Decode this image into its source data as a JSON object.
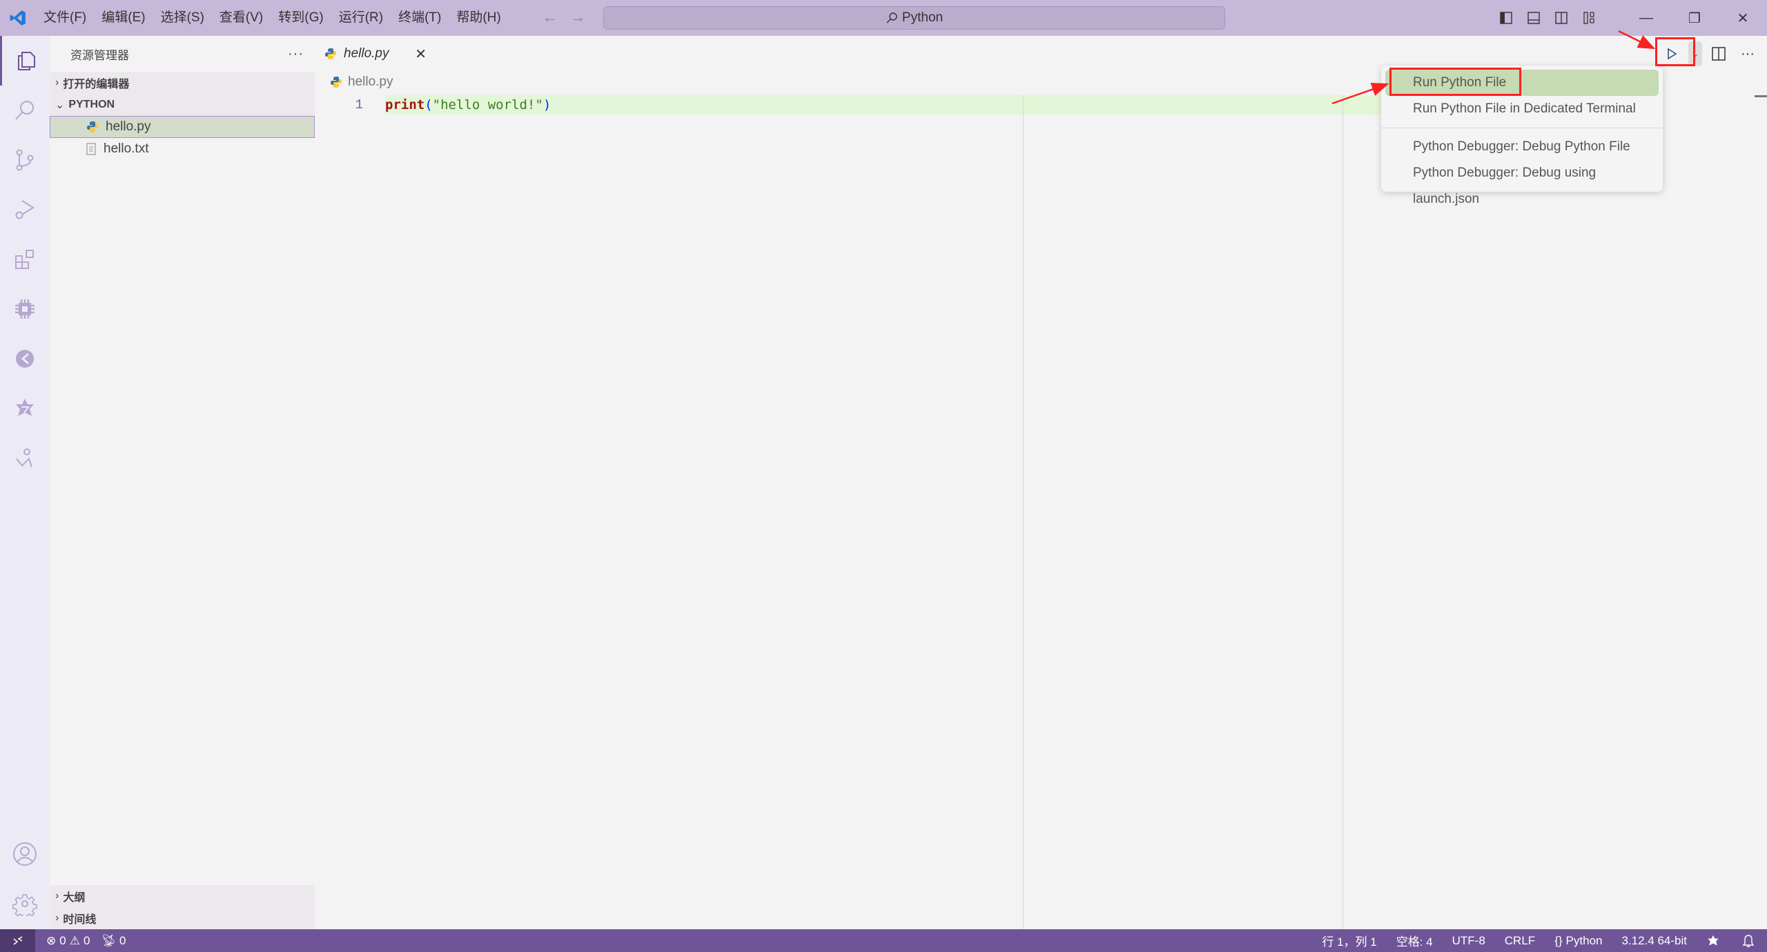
{
  "titlebar": {
    "menu": [
      "文件(F)",
      "编辑(E)",
      "选择(S)",
      "查看(V)",
      "转到(G)",
      "运行(R)",
      "终端(T)",
      "帮助(H)"
    ],
    "search_text": "Python",
    "nav_back": "←",
    "nav_forward": "→",
    "minimize": "—",
    "restore": "❐",
    "close": "✕"
  },
  "sidebar": {
    "title": "资源管理器",
    "more": "···",
    "open_editors": "打开的编辑器",
    "folder": "PYTHON",
    "files": [
      {
        "name": "hello.py",
        "icon": "python-icon",
        "selected": true
      },
      {
        "name": "hello.txt",
        "icon": "text-file-icon",
        "selected": false
      }
    ],
    "outline": "大纲",
    "timeline": "时间线"
  },
  "editor": {
    "tab": {
      "label": "hello.py",
      "close": "✕"
    },
    "breadcrumb": "hello.py",
    "lines": [
      {
        "number": "1",
        "tokens": [
          {
            "text": "print",
            "type": "fn"
          },
          {
            "text": "(",
            "type": "p"
          },
          {
            "text": "\"hello world!\"",
            "type": "s"
          },
          {
            "text": ")",
            "type": "p"
          }
        ]
      }
    ],
    "more": "···"
  },
  "run_menu": {
    "items": [
      {
        "label": "Run Python File",
        "active": true
      },
      {
        "label": "Run Python File in Dedicated Terminal",
        "active": false
      },
      {
        "label": "Python Debugger: Debug Python File",
        "active": false
      },
      {
        "label": "Python Debugger: Debug using launch.json",
        "active": false
      }
    ]
  },
  "statusbar": {
    "errors": "0",
    "warnings": "0",
    "ports": "0",
    "position": "行 1，列 1",
    "spaces": "空格: 4",
    "encoding": "UTF-8",
    "eol": "CRLF",
    "language": "Python",
    "interpreter": "3.12.4 64-bit"
  },
  "colors": {
    "titlebar": "#c5b8d8",
    "statusbar": "#6f5598",
    "accent": "#6f5599",
    "annotation": "#ff2020",
    "menu_active": "#c6dab4"
  }
}
